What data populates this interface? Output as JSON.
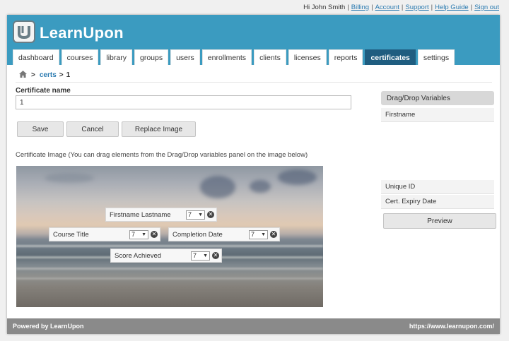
{
  "userbar": {
    "greeting": "Hi John Smith",
    "links": [
      "Billing",
      "Account",
      "Support",
      "Help Guide",
      "Sign out"
    ]
  },
  "app": {
    "logo_text": "LearnUpon"
  },
  "nav": {
    "tabs": [
      "dashboard",
      "courses",
      "library",
      "groups",
      "users",
      "enrollments",
      "clients",
      "licenses",
      "reports",
      "certificates",
      "settings"
    ],
    "active": "certificates"
  },
  "breadcrumb": {
    "arrow1": ">",
    "link": "certs",
    "arrow2": ">",
    "current": "1"
  },
  "form": {
    "cert_name_label": "Certificate name",
    "cert_name_value": "1",
    "save_label": "Save",
    "cancel_label": "Cancel",
    "replace_label": "Replace Image",
    "hint": "Certificate Image (You can drag elements from the Drag/Drop variables panel on the image below)"
  },
  "placed_variables": [
    {
      "label": "Firstname Lastname",
      "size": "7"
    },
    {
      "label": "Course Title",
      "size": "7"
    },
    {
      "label": "Completion Date",
      "size": "7"
    },
    {
      "label": "Score Achieved",
      "size": "7"
    }
  ],
  "panel": {
    "title": "Drag/Drop Variables",
    "items": [
      "Firstname",
      "Unique ID",
      "Cert. Expiry Date"
    ],
    "preview_label": "Preview"
  },
  "footer": {
    "left": "Powered by LearnUpon",
    "right": "https://www.learnupon.com/"
  },
  "colors": {
    "header": "#3b9bc0",
    "active_tab": "#1f5d80",
    "link": "#2a7ab0",
    "footer": "#8a8a8a"
  }
}
